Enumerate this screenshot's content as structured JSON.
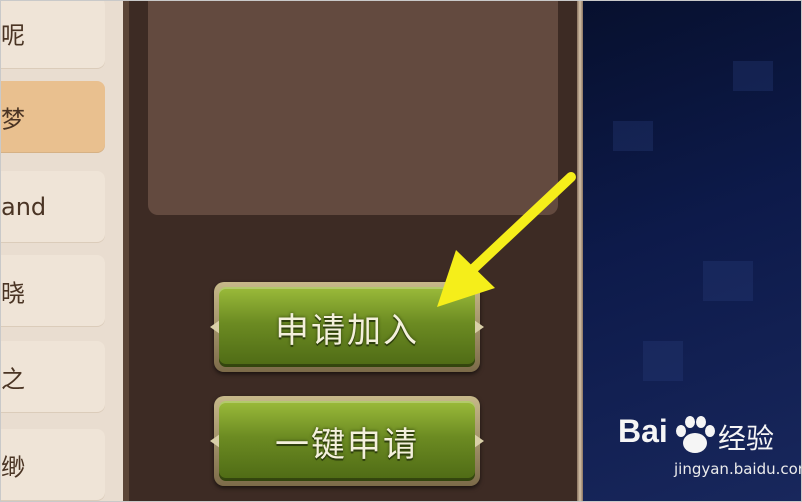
{
  "player_list": {
    "items": [
      {
        "label": "呢",
        "selected": false
      },
      {
        "label": "梦",
        "selected": true
      },
      {
        "label": "and",
        "selected": false
      },
      {
        "label": "晓",
        "selected": false
      },
      {
        "label": "之",
        "selected": false
      },
      {
        "label": "缈",
        "selected": false
      }
    ]
  },
  "actions": {
    "apply_join_label": "申请加入",
    "one_click_apply_label": "一键申请"
  },
  "watermark": {
    "logo_text": "Bai",
    "logo_text_cn": "经验",
    "url": "jingyan.baidu.com"
  },
  "colors": {
    "button_green": "#6c8b22",
    "arrow_yellow": "#f5ee1a",
    "selected_item": "#e9c08f"
  }
}
